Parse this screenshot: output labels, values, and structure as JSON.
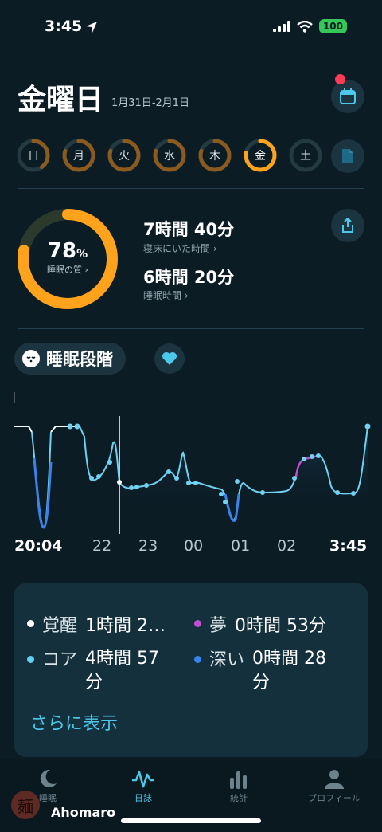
{
  "status": {
    "time": "3:45",
    "battery": "100"
  },
  "header": {
    "day": "金曜日",
    "date_range": "1月31日-2月1日"
  },
  "week": [
    {
      "label": "日",
      "progress": 0.4,
      "color": "#8a5a1e"
    },
    {
      "label": "月",
      "progress": 0.8,
      "color": "#8a5a1e"
    },
    {
      "label": "火",
      "progress": 0.8,
      "color": "#8a5a1e"
    },
    {
      "label": "水",
      "progress": 0.8,
      "color": "#8a5a1e"
    },
    {
      "label": "木",
      "progress": 0.8,
      "color": "#8a5a1e"
    },
    {
      "label": "金",
      "progress": 0.78,
      "color": "#ffa21c",
      "today": true
    },
    {
      "label": "土",
      "progress": 0,
      "color": "#8a5a1e"
    }
  ],
  "summary": {
    "score": "78",
    "score_unit": "%",
    "score_fraction": 0.78,
    "quality_label": "睡眠の質 ›",
    "time_in_bed": "7時間 40分",
    "time_in_bed_label": "寝床にいた時間 ›",
    "asleep": "6時間 20分",
    "asleep_label": "睡眠時間 ›"
  },
  "section": {
    "title": "睡眠段階"
  },
  "chart_data": {
    "type": "line",
    "x_ticks": [
      "20:04",
      "22",
      "23",
      "00",
      "01",
      "02",
      "3:45"
    ],
    "stages": [
      "覚醒",
      "夢",
      "コア",
      "深い"
    ]
  },
  "legend": [
    {
      "name": "覚醒",
      "value": "1時間 2…",
      "color": "#ffffff"
    },
    {
      "name": "夢",
      "value": "0時間 53分",
      "color": "#c04fd0"
    },
    {
      "name": "コア",
      "value": "4時間 57分",
      "color": "#5fd0f0"
    },
    {
      "name": "深い",
      "value": "0時間 28分",
      "color": "#3a82ec"
    }
  ],
  "legend_more": "さらに表示",
  "tabs": [
    {
      "label": "睡眠",
      "icon": "moon-icon"
    },
    {
      "label": "日誌",
      "icon": "wave-icon",
      "active": true
    },
    {
      "label": "統計",
      "icon": "bar-chart-icon"
    },
    {
      "label": "プロフィール",
      "icon": "person-icon"
    }
  ],
  "watermark": {
    "name": "Ahomaro",
    "seal": "麺"
  },
  "colors": {
    "background": "#0c1c25",
    "accent": "#4cc8ea",
    "score": "#ffa21c"
  }
}
